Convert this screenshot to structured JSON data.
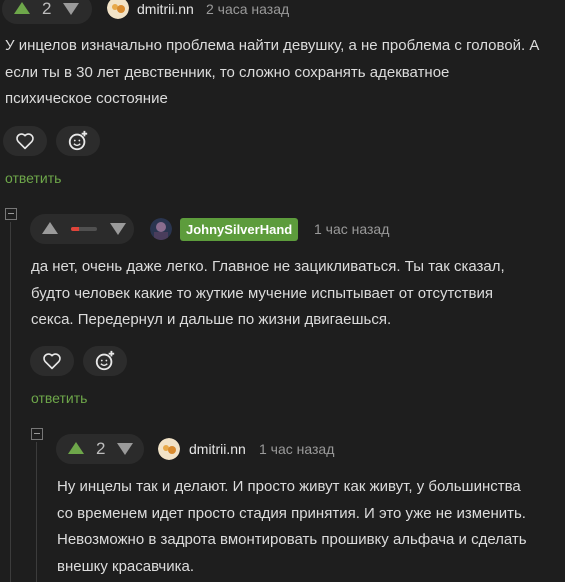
{
  "comments": [
    {
      "rating": "2",
      "username": "dmitrii.nn",
      "time": "2 часа назад",
      "text_lines": [
        "У инцелов изначально проблема найти девушку, а не проблема с головой. А",
        "если ты в 30 лет девственник, то сложно сохранять адекватное",
        "психическое состояние"
      ],
      "reply_label": "ответить"
    },
    {
      "rating": "",
      "rating_bar_color": "#e0443a",
      "username": "JohnySilverHand",
      "time": "1 час назад",
      "text_lines": [
        "да нет, очень даже легко. Главное не зацикливаться. Ты так сказал,",
        "будто человек какие то жуткие мучение испытывает от отсутствия",
        "секса. Передернул и дальше по жизни двигаешься."
      ],
      "reply_label": "ответить"
    },
    {
      "rating": "2",
      "username": "dmitrii.nn",
      "time": "1 час назад",
      "text_lines": [
        "Ну инцелы так и делают. И просто живут как живут, у большинства",
        "со временем идет просто стадия принятия. И это уже не изменить.",
        "Невозможно в задрота вмонтировать прошивку альфача и сделать",
        "внешку красавчика."
      ]
    }
  ],
  "colors": {
    "background": "#1e1e1e",
    "accent_green": "#6ea74a",
    "badge_green": "#5d9c3c"
  }
}
